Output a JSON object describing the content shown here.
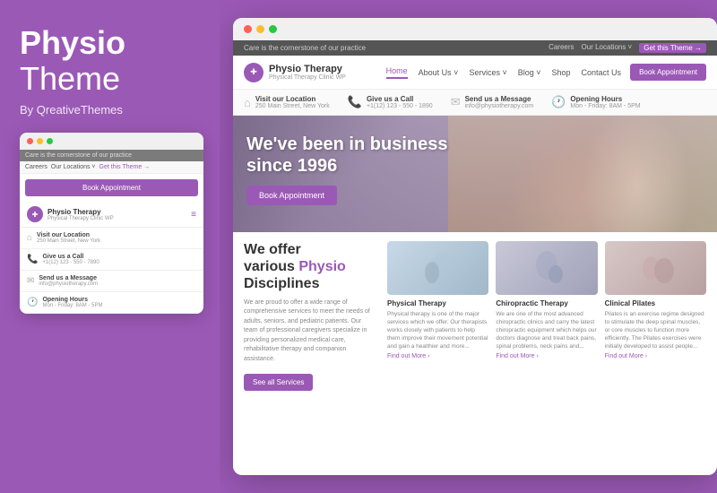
{
  "leftPanel": {
    "brand": {
      "title": "Physio",
      "subtitle": "Theme",
      "by": "By QreativeThemes"
    },
    "miniBrowser": {
      "topbar": "Care is the cornerstone of our practice",
      "navItems": [
        "Careers",
        "Our Locations ˅",
        "Get this Theme →"
      ],
      "bookBtn": "Book Appointment",
      "siteTitle": "Physio Therapy",
      "siteSub": "Physical Therapy Clinic WP",
      "infoItems": [
        {
          "label": "Visit our Location",
          "value": "250 Main Street, New York"
        },
        {
          "label": "Give us a Call",
          "value": "+1(12) 123 - 550 - 7890"
        },
        {
          "label": "Send us a Message",
          "value": "info@physiotherapy.com"
        },
        {
          "label": "Opening Hours",
          "value": "Mon - Friday: 8AM - 5PM"
        }
      ]
    }
  },
  "mainBrowser": {
    "topbar": {
      "text": "Care is the cornerstone of our practice",
      "links": [
        "Careers",
        "Our Locations ˅",
        "Get this Theme →"
      ]
    },
    "navbar": {
      "logoTitle": "Physio Therapy",
      "logoSub": "Physical Therapy Clinic WP",
      "links": [
        "Home",
        "About Us ˅",
        "Services ˅",
        "Blog ˅",
        "Shop",
        "Contact Us"
      ],
      "activeLink": "Home",
      "bookBtn": "Book Appointment"
    },
    "infoBar": [
      {
        "label": "Visit our Location",
        "value": "250 Main Street, New York"
      },
      {
        "label": "Give us a Call",
        "value": "+1(12) 123 - 550 - 1890"
      },
      {
        "label": "Send us a Message",
        "value": "info@physiotherapy.com"
      },
      {
        "label": "Opening Hours",
        "value": "Mon - Friday: 8AM - 5PM"
      }
    ],
    "hero": {
      "title": "We've been in business\nsince 1996",
      "bookBtn": "Book Appointment"
    },
    "content": {
      "heading": "We offer\nvarious Physio\nDisciplines",
      "text": "We are proud to offer a wide range of comprehensive services to meet the needs of adults, seniors, and pediatric patients. Our team of professional caregivers specialize in providing personalized medical care, rehabilitative therapy and companion assistance.",
      "servicesBtn": "See all Services"
    },
    "cards": [
      {
        "title": "Physical Therapy",
        "text": "Physical therapy is one of the major services which we offer. Our therapists works closely with patients to help them improve their movement potential and gain a healthier and more...",
        "findOut": "Find out More ›"
      },
      {
        "title": "Chiropractic Therapy",
        "text": "We are one of the most advanced chiropractic clinics and carry the latest chiropractic equipment which helps our doctors diagnose and treat back pains, spinal problems, neck pains and...",
        "findOut": "Find out More ›"
      },
      {
        "title": "Clinical Pilates",
        "text": "Pilates is an exercise regime designed to stimulate the deep spinal muscles, or core muscles to function more efficiently. The Pilates exercises were initially developed to assist people...",
        "findOut": "Find out More ›"
      }
    ]
  },
  "colors": {
    "primary": "#9b59b6",
    "textDark": "#333",
    "textMid": "#666",
    "textLight": "#999"
  }
}
